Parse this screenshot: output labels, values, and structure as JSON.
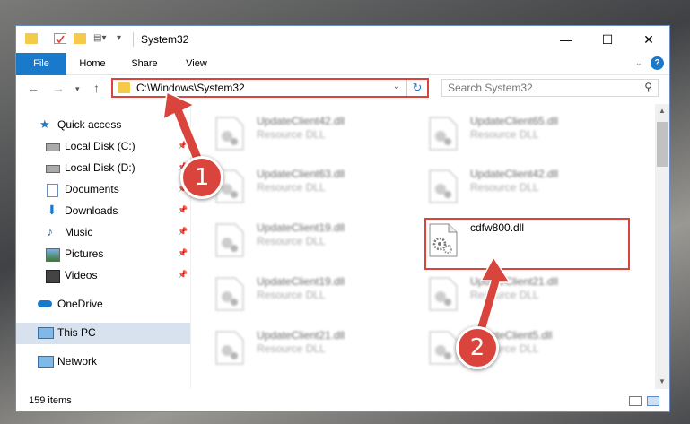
{
  "window": {
    "title": "System32",
    "controls": {
      "minimize": "—",
      "maximize": "☐",
      "close": "✕"
    }
  },
  "ribbon": {
    "tabs": [
      "File",
      "Home",
      "Share",
      "View"
    ],
    "help": "?"
  },
  "navigation": {
    "address": "C:\\Windows\\System32",
    "search_placeholder": "Search System32"
  },
  "sidebar": {
    "items": [
      {
        "label": "Quick access",
        "icon": "star-icon",
        "pinned": false
      },
      {
        "label": "Local Disk (C:)",
        "icon": "drive-icon",
        "pinned": true
      },
      {
        "label": "Local Disk (D:)",
        "icon": "drive-icon",
        "pinned": true
      },
      {
        "label": "Documents",
        "icon": "documents-icon",
        "pinned": true
      },
      {
        "label": "Downloads",
        "icon": "download-icon",
        "pinned": true
      },
      {
        "label": "Music",
        "icon": "music-icon",
        "pinned": true
      },
      {
        "label": "Pictures",
        "icon": "pictures-icon",
        "pinned": true
      },
      {
        "label": "Videos",
        "icon": "videos-icon",
        "pinned": true
      },
      {
        "label": "OneDrive",
        "icon": "cloud-icon",
        "pinned": false
      },
      {
        "label": "This PC",
        "icon": "computer-icon",
        "pinned": false,
        "selected": true
      },
      {
        "label": "Network",
        "icon": "network-icon",
        "pinned": false
      }
    ]
  },
  "files": [
    {
      "name": "UpdateClient42.dll",
      "type": "Resource DLL"
    },
    {
      "name": "UpdateClient65.dll",
      "type": "Resource DLL"
    },
    {
      "name": "UpdateClient63.dll",
      "type": "Resource DLL"
    },
    {
      "name": "UpdateClient42.dll",
      "type": "Resource DLL"
    },
    {
      "name": "UpdateClient19.dll",
      "type": "Resource DLL"
    },
    {
      "name": "cdfw800.dll",
      "type": "",
      "highlighted": true
    },
    {
      "name": "UpdateClient19.dll",
      "type": "Resource DLL"
    },
    {
      "name": "UpdateClient21.dll",
      "type": "Resource DLL"
    },
    {
      "name": "UpdateClient21.dll",
      "type": "Resource DLL"
    },
    {
      "name": "UpdateClient5.dll",
      "type": "Resource DLL"
    }
  ],
  "status": {
    "item_count": "159 items"
  },
  "annotations": {
    "step1": "1",
    "step2": "2",
    "color": "#d9453d"
  }
}
